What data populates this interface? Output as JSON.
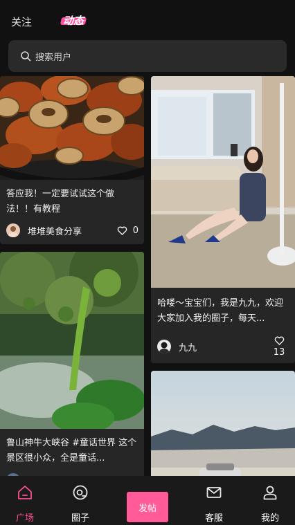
{
  "top_tabs": {
    "follow": "关注",
    "dynamic": "动态",
    "active": "dynamic"
  },
  "search": {
    "placeholder": "搜索用户"
  },
  "posts": [
    {
      "title": "答应我！一定要试试这个做法！！有教程",
      "author": "堆堆美食分享",
      "likes": "0"
    },
    {
      "title": "哈喽～宝宝们，我是九九，欢迎大家加入我的圈子，每天...",
      "author": "九九",
      "likes": "13"
    },
    {
      "title": "鲁山神牛大峡谷 #童话世界 这个景区很小众，全是童话...",
      "author": "",
      "likes": ""
    },
    {
      "title": "",
      "author": "",
      "likes": ""
    }
  ],
  "bottom_nav": {
    "home": "广场",
    "circle": "圈子",
    "post": "发帖",
    "service": "客服",
    "mine": "我的",
    "active": "home"
  },
  "colors": {
    "accent": "#ff5b98",
    "background": "#111111",
    "card": "#262626"
  }
}
